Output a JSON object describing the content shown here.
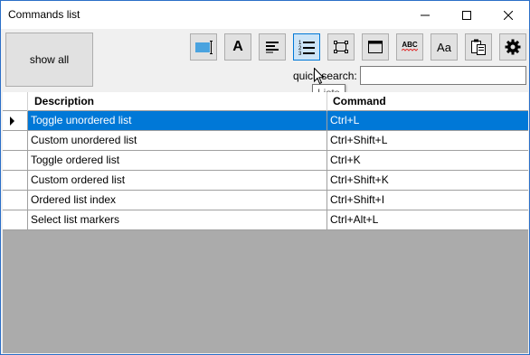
{
  "window": {
    "title": "Commands list"
  },
  "toolbar": {
    "show_all_label": "show all",
    "buttons": [
      {
        "icon": "highlight-rect-icon"
      },
      {
        "icon": "font-icon",
        "glyph": "A"
      },
      {
        "icon": "align-left-icon"
      },
      {
        "icon": "lists-icon",
        "active": true
      },
      {
        "icon": "selection-rect-icon"
      },
      {
        "icon": "window-icon"
      },
      {
        "icon": "spellcheck-icon",
        "glyph": "ABC"
      },
      {
        "icon": "case-icon",
        "glyph": "Aa"
      },
      {
        "icon": "clipboard-icon"
      },
      {
        "icon": "gear-icon"
      }
    ],
    "tooltip": "Lists",
    "quick_search_label": "quick search:",
    "quick_search_value": ""
  },
  "grid": {
    "columns": [
      "Description",
      "Command"
    ],
    "rows": [
      {
        "description": "Toggle unordered list",
        "command": "Ctrl+L",
        "selected": true
      },
      {
        "description": "Custom unordered list",
        "command": "Ctrl+Shift+L"
      },
      {
        "description": "Toggle ordered list",
        "command": "Ctrl+K"
      },
      {
        "description": "Custom ordered list",
        "command": "Ctrl+Shift+K"
      },
      {
        "description": "Ordered list index",
        "command": "Ctrl+Shift+I"
      },
      {
        "description": "Select list markers",
        "command": "Ctrl+Alt+L"
      }
    ]
  },
  "colors": {
    "selection": "#0078d7",
    "active_button_bg": "#cce4f7",
    "empty_area": "#ababab"
  }
}
